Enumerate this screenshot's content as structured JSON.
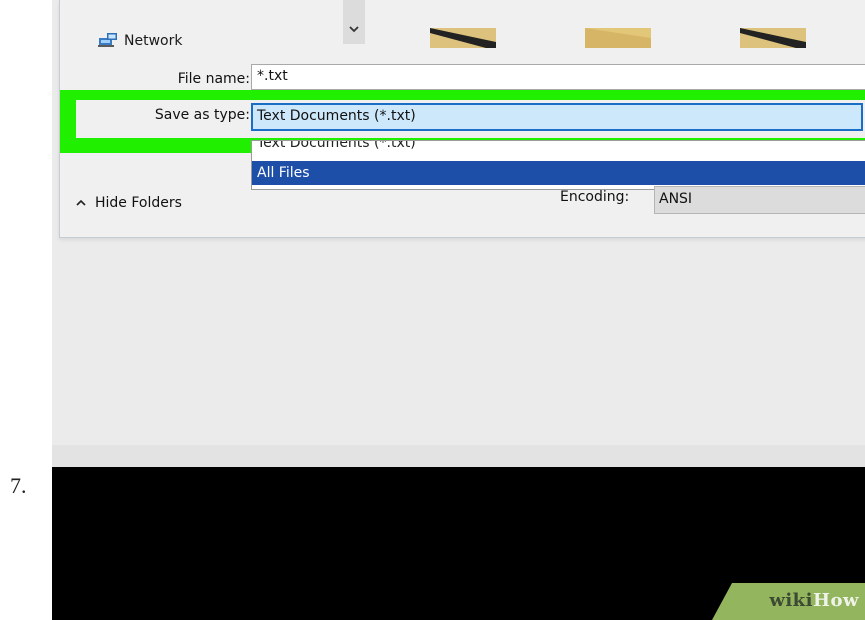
{
  "step": {
    "number": "7."
  },
  "dialog": {
    "nav_item": {
      "label": "Network",
      "icon": "network-icon"
    },
    "file_name": {
      "label": "File name:",
      "value": "*.txt"
    },
    "save_as_type": {
      "label": "Save as type:",
      "selected": "Text Documents (*.txt)",
      "options": [
        "Text Documents (*.txt)",
        "All Files"
      ]
    },
    "hide_folders": {
      "label": "Hide Folders",
      "icon": "chevron-up-icon"
    },
    "encoding": {
      "label": "Encoding:",
      "value": "ANSI"
    }
  },
  "watermark": {
    "wiki": "wiki",
    "how": "How"
  },
  "colors": {
    "highlight": "#21ef00",
    "selected_option": "#1d4fa8",
    "select_fill": "#cde8fb",
    "select_border": "#1b6ec7"
  }
}
